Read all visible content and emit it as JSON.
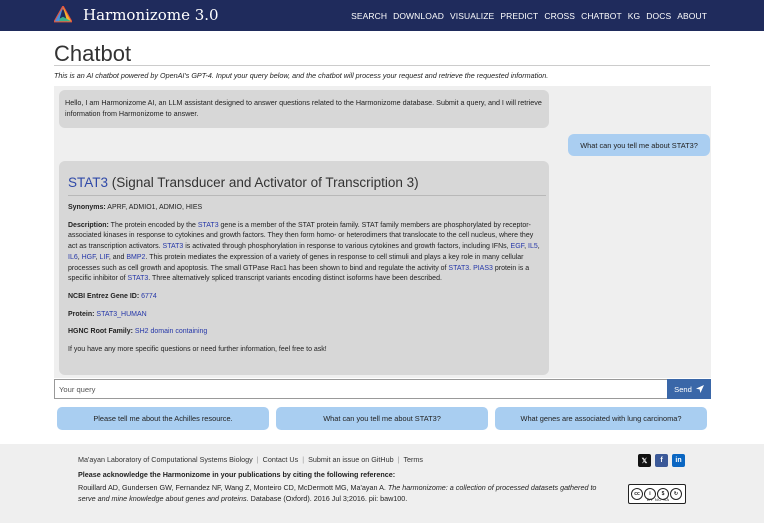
{
  "app": {
    "brand": "Harmonizome 3.0",
    "nav": [
      "SEARCH",
      "DOWNLOAD",
      "VISUALIZE",
      "PREDICT",
      "CROSS",
      "CHATBOT",
      "KG",
      "DOCS",
      "ABOUT"
    ]
  },
  "page": {
    "title": "Chatbot",
    "intro": "This is an AI chatbot powered by OpenAI's GPT-4. Input your query below, and the chatbot will process your request and retrieve the requested information."
  },
  "chat": {
    "greeting": "Hello, I am Harmonizome AI, an LLM assistant designed to answer questions related to the Harmonizome database. Submit a query, and I will retrieve information from Harmonizome to answer.",
    "user_message": "What can you tell me about STAT3?",
    "answer": {
      "symbol": "STAT3",
      "full_name": "(Signal Transducer and Activator of Transcription 3)",
      "synonyms_label": "Synonyms:",
      "synonyms": "APRF, ADMIO1, ADMIO, HIES",
      "description_label": "Description:",
      "desc": {
        "t1": "The protein encoded by the ",
        "l1": "STAT3",
        "t2": " gene is a member of the STAT protein family. STAT family members are phosphorylated by receptor-associated kinases in response to cytokines and growth factors. They then form homo- or heterodimers that translocate to the cell nucleus, where they act as transcription activators. ",
        "l2": "STAT3",
        "t3": " is activated through phosphorylation in response to various cytokines and growth factors, including IFNs, ",
        "l3": "EGF",
        "t4": ", ",
        "l4": "IL5",
        "t5": ", ",
        "l5": "IL6",
        "t6": ", ",
        "l6": "HGF",
        "t7": ", ",
        "l7": "LIF",
        "t8": ", and ",
        "l8": "BMP2",
        "t9": ". This protein mediates the expression of a variety of genes in response to cell stimuli and plays a key role in many cellular processes such as cell growth and apoptosis. The small GTPase Rac1 has been shown to bind and regulate the activity of ",
        "l9": "STAT3",
        "t10": ". ",
        "l10": "PIAS3",
        "t11": " protein is a specific inhibitor of ",
        "l11": "STAT3",
        "t12": ". Three alternatively spliced transcript variants encoding distinct isoforms have been described."
      },
      "entrez_label": "NCBI Entrez Gene ID:",
      "entrez_id": "6774",
      "protein_label": "Protein:",
      "protein": "STAT3_HUMAN",
      "hgnc_label": "HGNC Root Family:",
      "hgnc": "SH2 domain containing",
      "closing": "If you have any more specific questions or need further information, feel free to ask!"
    }
  },
  "input": {
    "placeholder": "Your query",
    "send_label": "Send"
  },
  "suggestions": [
    "Please tell me about the Achilles resource.",
    "What can you tell me about STAT3?",
    "What genes are associated with lung carcinoma?"
  ],
  "footer": {
    "links": [
      "Ma'ayan Laboratory of Computational Systems Biology",
      "Contact Us",
      "Submit an issue on GitHub",
      "Terms"
    ],
    "ack": "Please acknowledge the Harmonizome in your publications by citing the following reference:",
    "cite_authors": "Rouillard AD, Gundersen GW, Fernandez NF, Wang Z, Monteiro CD, McDermott MG, Ma'ayan A. ",
    "cite_title": "The harmonizome: a collection of processed datasets gathered to serve and mine knowledge about genes and proteins.",
    "cite_rest": " Database (Oxford). 2016 Jul 3;2016. pii: baw100.",
    "social": [
      "𝕏",
      "f",
      "in"
    ],
    "license": "BY NC SA"
  },
  "colors": {
    "navbar": "#1f2b5c",
    "link": "#2537a8",
    "send": "#3a67a8",
    "user_bubble": "#aacef1",
    "bot_bubble": "#d7d7d7"
  }
}
